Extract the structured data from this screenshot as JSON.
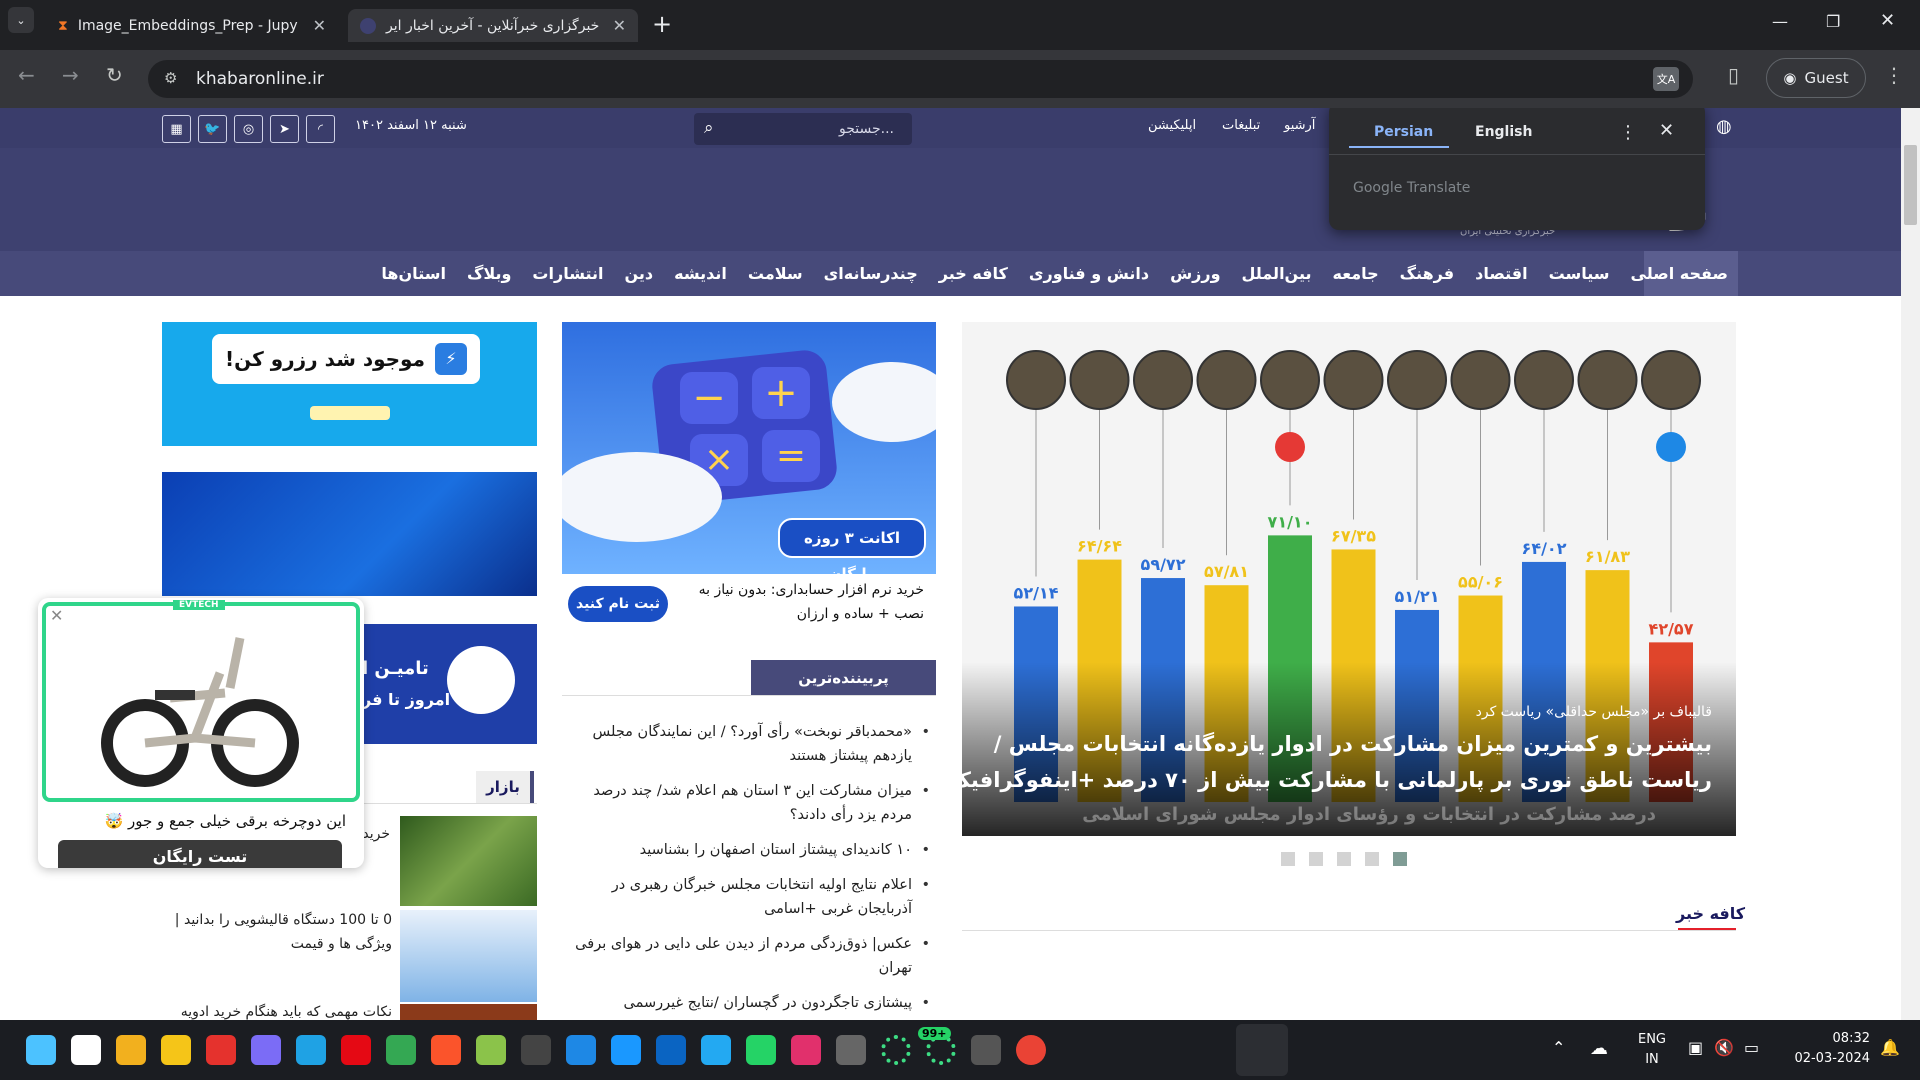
{
  "browser": {
    "tabs": [
      {
        "title": "Image_Embeddings_Prep - Jupy",
        "active": false
      },
      {
        "title": "خبرگزاری خبرآنلاین - آخرین اخبار ایر",
        "active": true
      }
    ],
    "new_tab": "+",
    "url": "khabaronline.ir",
    "profile": "Guest"
  },
  "translate_popup": {
    "tabs": [
      "Persian",
      "English"
    ],
    "brand": "Google Translate"
  },
  "topbar": {
    "links": [
      "آرشیو",
      "تبلیغات",
      "اپلیکیشن"
    ],
    "search_placeholder": "جستجو...",
    "date": "شنبه ۱۲ اسفند ۱۴۰۲"
  },
  "masthead": {
    "tagline": "خبرگزاری تحلیلی ایران"
  },
  "nav": [
    "صفحه اصلی",
    "سیاست",
    "اقتصاد",
    "فرهنگ",
    "جامعه",
    "بین‌الملل",
    "ورزش",
    "دانش و فناوری",
    "کافه خبر",
    "چندرسانه‌ای",
    "سلامت",
    "اندیشه",
    "دین",
    "انتشارات",
    "وبلاگ",
    "استان‌ها"
  ],
  "hero": {
    "kicker": "قالیباف بر «مجلس حداقلی» ریاست کرد",
    "headline_1": "بیشترین و کمترین میزان مشارکت در ادوار یازده‌گانه انتخابات مجلس /",
    "headline_2": "ریاست ناطق نوری بر پارلمانی با مشارکت بیش از ۷۰ درصد +اینفوگرافیک",
    "caption": "درصد مشارکت در انتخابات و رؤسای ادوار مجلس شورای اسلامی",
    "bar_labels": [
      "۵۲/۱۴",
      "۶۴/۶۴",
      "۵۹/۷۲",
      "۵۷/۸۱",
      "۷۱/۱۰",
      "۶۷/۳۵",
      "۵۱/۲۱",
      "۵۵/۰۶",
      "۶۴/۰۲",
      "۶۱/۸۳",
      "۴۲/۵۷"
    ],
    "bar_values": [
      52.14,
      64.64,
      59.72,
      57.81,
      71.1,
      67.35,
      51.21,
      55.06,
      64.02,
      61.83,
      42.57
    ],
    "bar_colors": [
      "#2d6fd6",
      "#f0c21a",
      "#2d6fd6",
      "#f0c21a",
      "#3fae49",
      "#f0c21a",
      "#2d6fd6",
      "#f0c21a",
      "#2d6fd6",
      "#f0c21a",
      "#e0452b"
    ],
    "slider_dots": 5
  },
  "cafe_khabar": "کافه خبر",
  "ad_accounting": {
    "badge": "اکانت ۳ روزه رایگان",
    "text": "خرید نرم افزار حسابداری: بدون نیاز به نصب + ساده و ارزان",
    "button": "ثبت نام کنید"
  },
  "most_viewed": {
    "title": "پربیننده‌ترین",
    "items": [
      "«محمدباقر نوبخت» رأی آورد؟ / این نمایندگان مجلس یازدهم پیشتاز هستند",
      "میزان مشارکت این ۳ استان هم اعلام شد/ چند درصد مردم یزد رأی دادند؟",
      "۱۰ کاندیدای پیشتاز استان اصفهان را بشناسید",
      "اعلام نتایج اولیه انتخابات مجلس خبرگان رهبری در آذربایجان غربی +اسامی",
      "عکس| ذوق‌زدگی مردم از دیدن علی دایی در هوای برفی تهران",
      "پیشتازی تاجگردون در گچساران /نتایج غیررسمی"
    ]
  },
  "ad_reserve": {
    "text": "موجود شد رزرو کن!"
  },
  "ad_tamin": {
    "text_1": "تامیـن ا",
    "text_2": "امروز تا فر"
  },
  "bazaar": {
    "title": "بازار",
    "items": [
      "خرید پالیز",
      "0 تا 100 دستگاه قالیشویی را بدانید | ویژگی ها و قیمت",
      "نکات مهمی که باید هنگام خرید ادویه"
    ]
  },
  "popup_ad": {
    "brand": "EVTECH",
    "text": "این دوچرخه برقی خیلی جمع و جور 🤯",
    "button": "تست رایگان"
  },
  "taskbar": {
    "lang_1": "ENG",
    "lang_2": "IN",
    "time": "08:32",
    "date": "02-03-2024",
    "whatsapp_badge": "99+"
  }
}
